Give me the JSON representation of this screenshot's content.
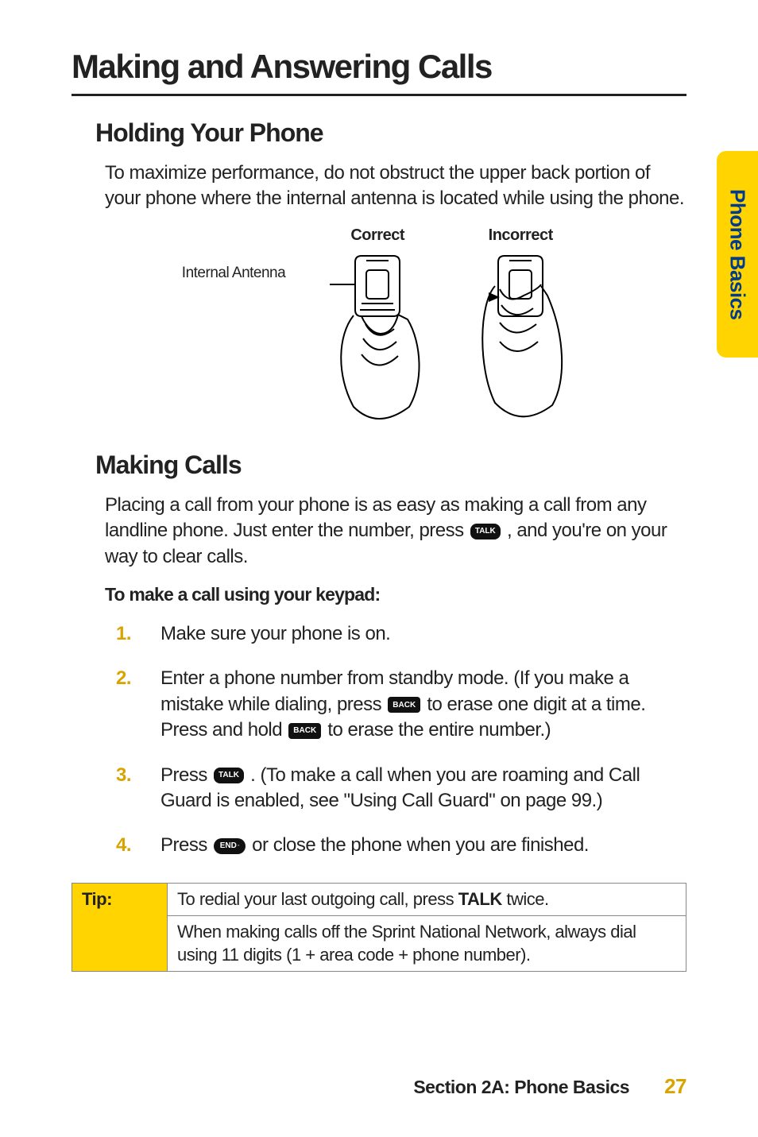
{
  "sidebar_tab": "Phone Basics",
  "h1": "Making and Answering Calls",
  "section1": {
    "h2": "Holding Your Phone",
    "p": "To maximize performance, do not obstruct the upper back portion of your phone where the internal antenna is located while using the phone.",
    "labels": {
      "correct": "Correct",
      "incorrect": "Incorrect",
      "internal_antenna": "Internal Antenna"
    }
  },
  "section2": {
    "h2": "Making Calls",
    "p_parts": {
      "a": "Placing a call from your phone is as easy as making a call from any landline phone. Just enter the number, press ",
      "b": " , and you're on your way to clear calls."
    },
    "lead": "To make a call using your keypad:",
    "steps": {
      "s1": "Make sure your phone is on.",
      "s2": {
        "a": "Enter a phone number from standby mode. (If you make a mistake while dialing, press ",
        "b": " to erase one digit at a time. Press and hold ",
        "c": " to erase the entire number.)"
      },
      "s3": {
        "a": "Press ",
        "b": " . (To make a call when you are roaming and Call Guard is enabled, see \"Using Call Guard\" on page 99.)"
      },
      "s4": {
        "a": "Press ",
        "b": " or close the phone when you are finished."
      }
    }
  },
  "keys": {
    "talk": "TALK",
    "back": "BACK",
    "end": "END"
  },
  "tip": {
    "label": "Tip:",
    "row1": {
      "a": "To redial your last outgoing call, press ",
      "bold": "TALK",
      "b": " twice."
    },
    "row2": "When making calls off the Sprint National Network, always dial using 11 digits (1 + area code + phone number)."
  },
  "footer": {
    "section": "Section 2A: Phone Basics",
    "page": "27"
  }
}
